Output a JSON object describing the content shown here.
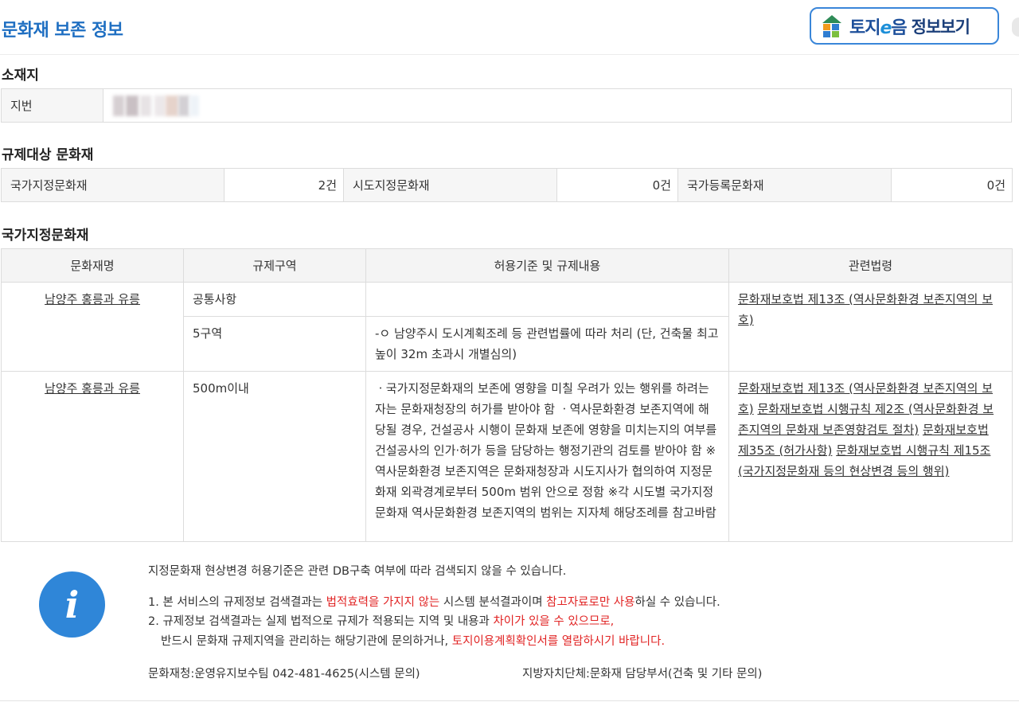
{
  "header": {
    "title": "문화재 보존 정보",
    "tojieum_brand": "토지",
    "tojieum_brand_e": "e",
    "tojieum_brand_end": "음",
    "tojieum_label": "정보보기"
  },
  "location": {
    "section_title": "소재지",
    "label": "지번"
  },
  "counts": {
    "section_title": "규제대상 문화재",
    "items": [
      {
        "label": "국가지정문화재",
        "value": "2건"
      },
      {
        "label": "시도지정문화재",
        "value": "0건"
      },
      {
        "label": "국가등록문화재",
        "value": "0건"
      }
    ]
  },
  "detail": {
    "section_title": "국가지정문화재",
    "columns": [
      "문화재명",
      "규제구역",
      "허용기준 및 규제내용",
      "관련법령"
    ],
    "rows": [
      {
        "name": "남양주 홍릉과 유릉",
        "sub": [
          {
            "zone": "공통사항",
            "content": ""
          },
          {
            "zone": "5구역",
            "content": "-ㅇ 남양주시 도시계획조례 등 관련법률에 따라 처리 (단, 건축물 최고높이 32m 초과시 개별심의)"
          }
        ],
        "laws": [
          "문화재보호법 제13조 (역사문화환경 보존지역의 보호)"
        ]
      },
      {
        "name": "남양주 홍릉과 유릉",
        "zone": "500m이내",
        "content": "ㆍ국가지정문화재의 보존에 영향을 미칠 우려가 있는 행위를 하려는 자는 문화재청장의 허가를 받아야 함 ㆍ역사문화환경 보존지역에 해당될 경우, 건설공사 시행이 문화재 보존에 영향을 미치는지의 여부를 건설공사의 인가·허가 등을 담당하는 행정기관의 검토를 받아야 함 ※역사문화환경 보존지역은 문화재청장과 시도지사가 협의하여 지정문화재 외곽경계로부터 500m 범위 안으로 정함 ※각 시도별 국가지정문화재 역사문화환경 보존지역의 범위는 지자체 해당조례를 참고바람",
        "laws": [
          "문화재보호법 제13조 (역사문화환경 보존지역의 보호)",
          "문화재보호법 시행규칙 제2조 (역사문화환경 보존지역의 문화재 보존영향검토 절차)",
          "문화재보호법 제35조 (허가사항)",
          "문화재보호법 시행규칙 제15조 (국가지정문화재 등의 현상변경 등의 행위)"
        ]
      }
    ]
  },
  "notice": {
    "intro": "지정문화재 현상변경 허용기준은 관련 DB구축 여부에 따라 검색되지 않을 수 있습니다.",
    "line1_a": "1. 본 서비스의 규제정보 검색결과는 ",
    "line1_red1": "법적효력을 가지지 않는",
    "line1_b": " 시스템 분석결과이며 ",
    "line1_red2": "참고자료로만 사용",
    "line1_c": "하실 수 있습니다.",
    "line2_a": "2. 규제정보 검색결과는 실제 법적으로 규제가 적용되는 지역 및 내용과 ",
    "line2_red": "차이가 있을 수 있으므로,",
    "line3_a": "반드시 문화재 규제지역을 관리하는 해당기관에 문의하거나, ",
    "line3_red": "토지이용계획확인서를 열람하시기 바랍니다.",
    "contact1": "문화재청:운영유지보수팀 042-481-4625(시스템 문의)",
    "contact2": "지방자치단체:문화재 담당부서(건축 및 기타 문의)"
  },
  "colors": {
    "accent": "#1f6fc2",
    "warning": "#e12424",
    "info_icon": "#2f86d8"
  }
}
